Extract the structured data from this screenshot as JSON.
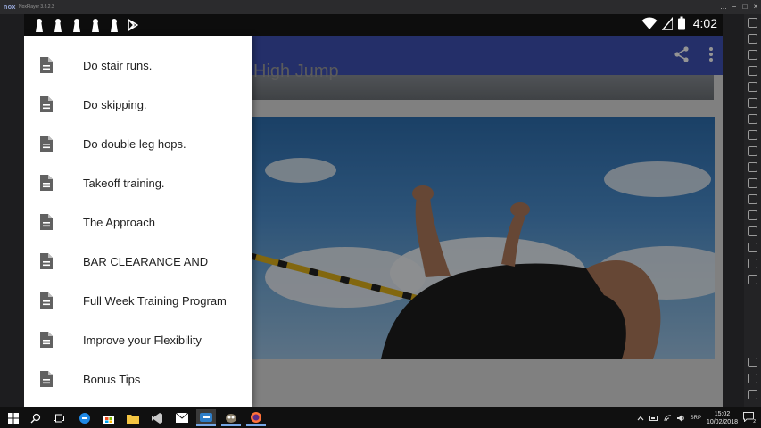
{
  "emulator": {
    "logo": "nox",
    "version": "NoxPlayer 3.8.2.3",
    "window_controls": [
      "−",
      "□",
      "×",
      "…"
    ]
  },
  "status_bar": {
    "time": "4:02",
    "notification_icons": [
      "chess-pawn-icon",
      "chess-pawn-icon",
      "chess-pawn-icon",
      "chess-pawn-icon",
      "chess-pawn-icon",
      "play-store-icon"
    ],
    "right_icons": [
      "wifi-icon",
      "signal-icon",
      "battery-icon"
    ]
  },
  "app": {
    "title": "High Jump",
    "actions": [
      "share-icon",
      "more-vert-icon"
    ]
  },
  "drawer": {
    "items": [
      {
        "label": "Do stair runs.",
        "icon": "document-icon"
      },
      {
        "label": "Do skipping.",
        "icon": "document-icon"
      },
      {
        "label": "Do double leg hops.",
        "icon": "document-icon"
      },
      {
        "label": "Takeoff training.",
        "icon": "document-icon"
      },
      {
        "label": "The Approach",
        "icon": "document-icon"
      },
      {
        "label": "BAR CLEARANCE AND",
        "icon": "document-icon"
      },
      {
        "label": "Full Week Training Program",
        "icon": "document-icon"
      },
      {
        "label": "Improve your Flexibility",
        "icon": "document-icon"
      },
      {
        "label": "Bonus Tips",
        "icon": "document-icon"
      }
    ]
  },
  "taskbar": {
    "apps": [
      "windows-start-icon",
      "search-icon",
      "task-view-icon",
      "edge-icon",
      "store-icon",
      "file-explorer-icon",
      "visual-studio-icon",
      "mail-icon",
      "nox-icon",
      "gimp-icon",
      "firefox-icon"
    ],
    "tray": {
      "language": "SRP",
      "time": "15:02",
      "date": "10/02/2018",
      "notification_count": "2"
    }
  },
  "colors": {
    "app_bar": "#3f51b5",
    "drawer_bg": "#ffffff",
    "doc_icon": "#616161",
    "scrim": "rgba(0,0,0,0.42)",
    "status_bar": "#0d0d0d"
  }
}
